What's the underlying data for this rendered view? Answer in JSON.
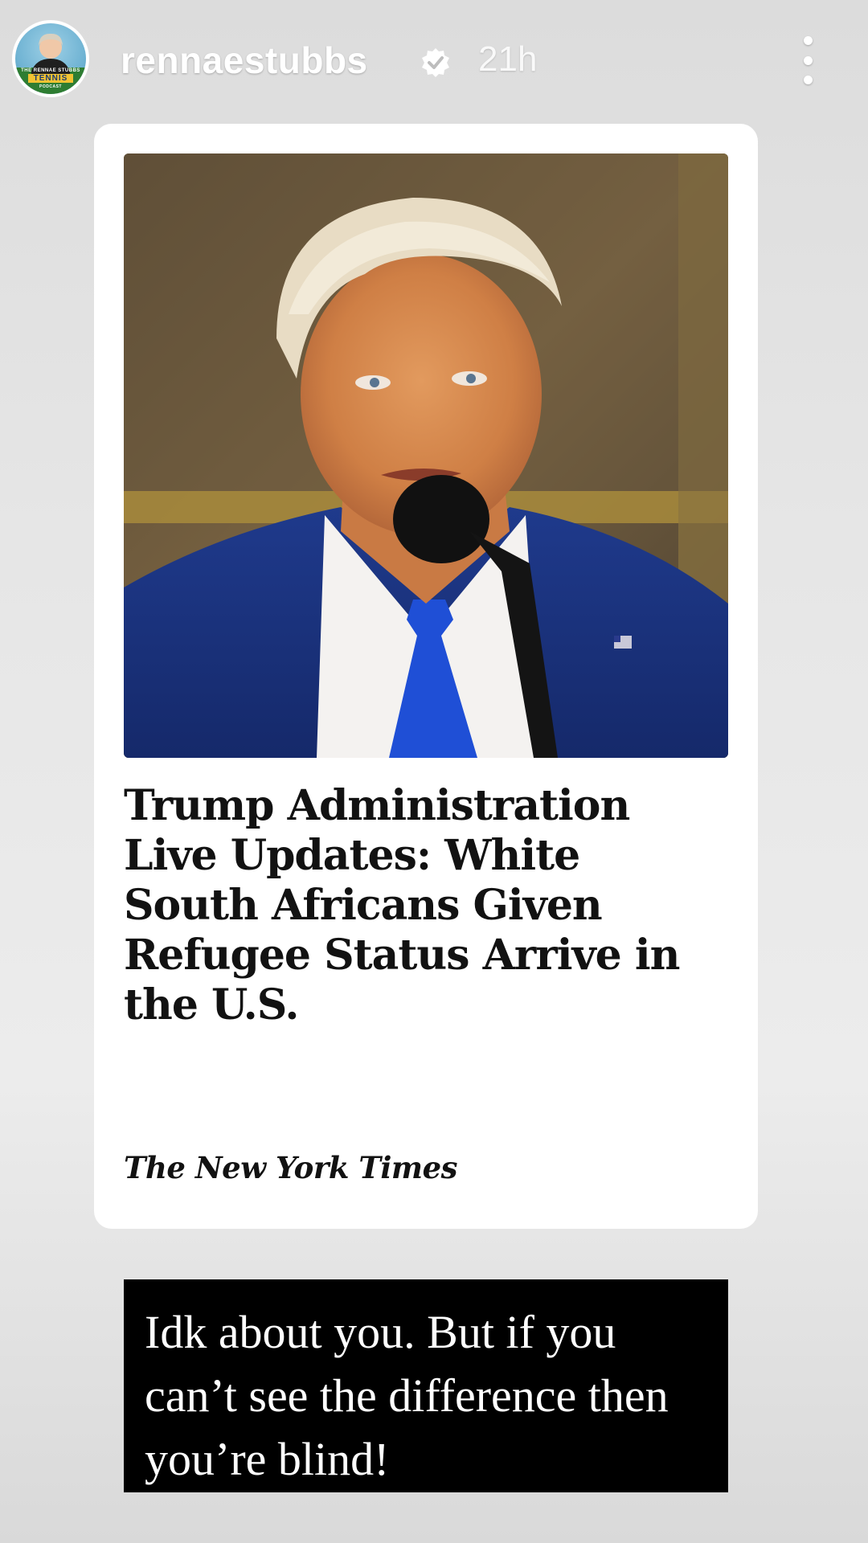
{
  "header": {
    "username": "rennaestubbs",
    "timestamp": "21h",
    "verified_icon": "verified-badge-icon",
    "menu_icon": "more-vertical-icon",
    "avatar": {
      "text_line1": "THE RENNAE STUBBS",
      "text_line2": "TENNIS",
      "text_line3": "PODCAST"
    }
  },
  "article": {
    "headline": "Trump Administration Live Updates: White South Africans Given Refugee Status Arrive in the U.S.",
    "publisher": "The New York Times"
  },
  "caption": {
    "text": "Idk about you. But if you can’t see the difference then you’re blind!"
  },
  "colors": {
    "background": "#e4e4e4",
    "card": "#ffffff",
    "caption_background": "#000000",
    "caption_text": "#ffffff",
    "username_text": "#ffffff"
  }
}
